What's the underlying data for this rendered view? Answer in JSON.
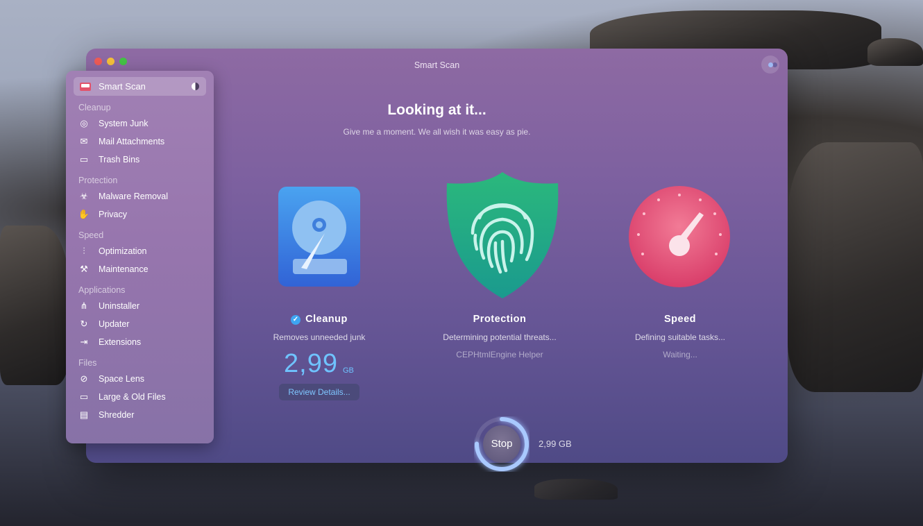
{
  "window": {
    "title": "Smart Scan"
  },
  "sidebar": {
    "selected": {
      "label": "Smart Scan"
    },
    "sections": {
      "cleanup": "Cleanup",
      "protection": "Protection",
      "speed": "Speed",
      "applications": "Applications",
      "files": "Files"
    },
    "items": {
      "system_junk": "System Junk",
      "mail_attachments": "Mail Attachments",
      "trash_bins": "Trash Bins",
      "malware_removal": "Malware Removal",
      "privacy": "Privacy",
      "optimization": "Optimization",
      "maintenance": "Maintenance",
      "uninstaller": "Uninstaller",
      "updater": "Updater",
      "extensions": "Extensions",
      "space_lens": "Space Lens",
      "large_old_files": "Large & Old Files",
      "shredder": "Shredder"
    }
  },
  "main": {
    "heading": "Looking at it...",
    "subheading": "Give me a moment. We all wish it was easy as pie.",
    "cleanup": {
      "title": "Cleanup",
      "description": "Removes unneeded junk",
      "size_value": "2,99",
      "size_unit": "GB",
      "review_label": "Review Details..."
    },
    "protection": {
      "title": "Protection",
      "description": "Determining potential threats...",
      "status": "CEPHtmlEngine Helper"
    },
    "speed": {
      "title": "Speed",
      "description": "Defining suitable tasks...",
      "status": "Waiting..."
    },
    "stop": {
      "label": "Stop",
      "size": "2,99 GB"
    }
  },
  "colors": {
    "accent_blue": "#3ea5f2",
    "cleanup_icon": "#3a7fe0",
    "protection_icon": "#1fa884",
    "speed_icon": "#e8557a"
  },
  "icons": {
    "cleanup": "hard-drive-icon",
    "protection": "fingerprint-shield-icon",
    "speed": "speedometer-icon"
  }
}
